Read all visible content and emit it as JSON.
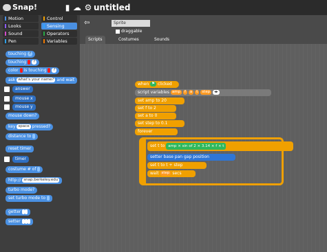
{
  "app": {
    "title": "untitled",
    "logo_text": "Snap!"
  },
  "categories": [
    {
      "label": "Motion",
      "color": "#4a90e2"
    },
    {
      "label": "Control",
      "color": "#f0a000"
    },
    {
      "label": "Looks",
      "color": "#8c5cf6"
    },
    {
      "label": "Sensing",
      "color": "#2fa4ff"
    },
    {
      "label": "Sound",
      "color": "#d14cc8"
    },
    {
      "label": "Operators",
      "color": "#28a745"
    },
    {
      "label": "Pen",
      "color": "#2e9fe7"
    },
    {
      "label": "Variables",
      "color": "#f07a00"
    }
  ],
  "palette": {
    "blocks": [
      "touching",
      "touching",
      "color",
      "is touching",
      "ask",
      "what's your name?",
      "and wait",
      "answer",
      "mouse x",
      "mouse y",
      "mouse down?",
      "key",
      "space",
      "pressed?",
      "distance to",
      "reset timer",
      "timer",
      "costume #",
      "of",
      "http://",
      "snap.berkeley.edu",
      "turbo mode?",
      "set turbo mode to",
      "getter",
      "setter"
    ]
  },
  "sprite": {
    "name": "Sprite",
    "draggable_label": "draggable"
  },
  "tabs": [
    "Scripts",
    "Costumes",
    "Sounds"
  ],
  "script": {
    "when_label": "when",
    "clicked_label": "clicked",
    "script_variables": "script variables",
    "vars": [
      "amp",
      "f",
      "a",
      "t",
      "step"
    ],
    "set_amp": "set amp to 20",
    "set_f": "set f to 2",
    "set_a": "set a to 0",
    "set_step": "set step to 0.1",
    "forever": "forever",
    "set_t": "set t to",
    "expr": "amp × sin of 2 × 3.14 × f × t",
    "setter": "setter base pan gap position",
    "set_t_step": "set t to t + step",
    "wait": "wait",
    "wait_step": "step",
    "wait_secs": "secs"
  }
}
